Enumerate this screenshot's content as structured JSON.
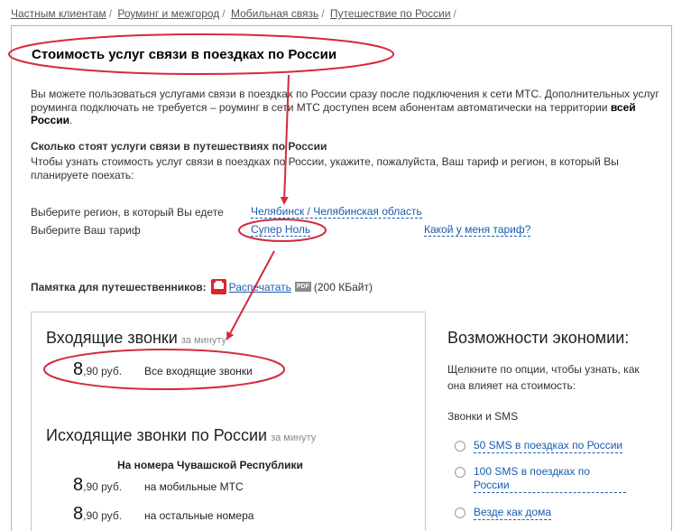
{
  "breadcrumb": {
    "items": [
      "Частным клиентам",
      "Роуминг и межгород",
      "Мобильная связь",
      "Путешествие по России"
    ],
    "separator": "/"
  },
  "page": {
    "title": "Стоимость услуг связи в поездках по России",
    "intro_part1": "Вы можете пользоваться услугами связи в поездках по России сразу после подключения к сети МТС. Дополнительных услуг роуминга подключать не требуется – роуминг в сети МТС доступен всем абонентам автоматически на территории ",
    "intro_bold": "всей России",
    "intro_end": ".",
    "question_title": "Сколько стоят услуги связи в путешествиях по России",
    "question_text": "Чтобы узнать стоимость услуг связи в поездках по России, укажите, пожалуйста, Ваш тариф и регион, в который Вы планируете поехать:"
  },
  "selectors": {
    "region_label": "Выберите регион, в который Вы едете",
    "region_value": "Челябинск / Челябинская область",
    "tariff_label": "Выберите Ваш тариф",
    "tariff_value": "Супер Ноль",
    "which_tariff": "Какой у меня тариф?"
  },
  "memo": {
    "label": "Памятка для путешественников:",
    "print_link": "Распечатать",
    "pdf_badge": "PDF",
    "size": "(200 КБайт)"
  },
  "incoming": {
    "title": "Входящие звонки",
    "per": "за минуту",
    "price_int": "8",
    "price_frac": ",90 руб.",
    "desc": "Все входящие звонки"
  },
  "outgoing": {
    "title": "Исходящие звонки по России",
    "per": "за минуту",
    "subtitle": "На номера Чувашской Республики",
    "rows": [
      {
        "price_int": "8",
        "price_frac": ",90 руб.",
        "desc": "на мобильные МТС"
      },
      {
        "price_int": "8",
        "price_frac": ",90 руб.",
        "desc": "на остальные номера"
      }
    ]
  },
  "economy": {
    "title": "Возможности экономии:",
    "text": "Щелкните по опции, чтобы узнать, как она влияет на стоимость:",
    "sub": "Звонки и SMS",
    "options": [
      "50 SMS в поездках по России",
      "100 SMS в поездках по России",
      "Везде как дома"
    ]
  },
  "colors": {
    "annotation": "#d42a3c",
    "link": "#1a5cb0",
    "print_icon": "#d8262b"
  }
}
